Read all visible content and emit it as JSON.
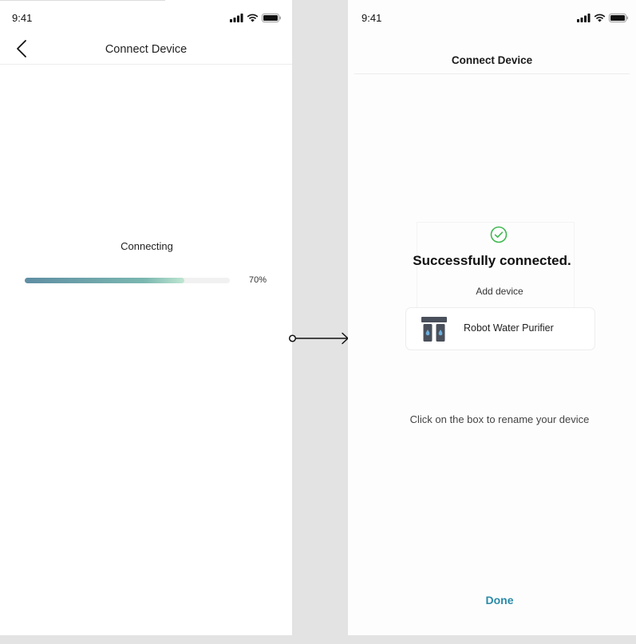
{
  "left_screen": {
    "status_time": "9:41",
    "nav_title": "Connect Device",
    "connecting_label": "Connecting",
    "progress": {
      "value": 0.78,
      "label": "70%"
    }
  },
  "right_screen": {
    "status_time": "9:41",
    "nav_title": "Connect Device",
    "success_title": "Successfully connected.",
    "add_device_label": "Add device",
    "device_name": "Robot Water Purifier",
    "rename_hint": "Click on the box to rename your device",
    "done_label": "Done"
  },
  "colors": {
    "accent": "#2a8aa8",
    "success": "#3fb850",
    "progress_start": "#5f8ea3",
    "progress_end": "#bfe6d2",
    "device_icon": "#4a505b",
    "device_water": "#6aaede"
  },
  "icons": [
    "signal-icon",
    "wifi-icon",
    "battery-icon",
    "back-chevron-icon",
    "check-circle-icon",
    "water-purifier-icon",
    "arrow-right-icon"
  ]
}
